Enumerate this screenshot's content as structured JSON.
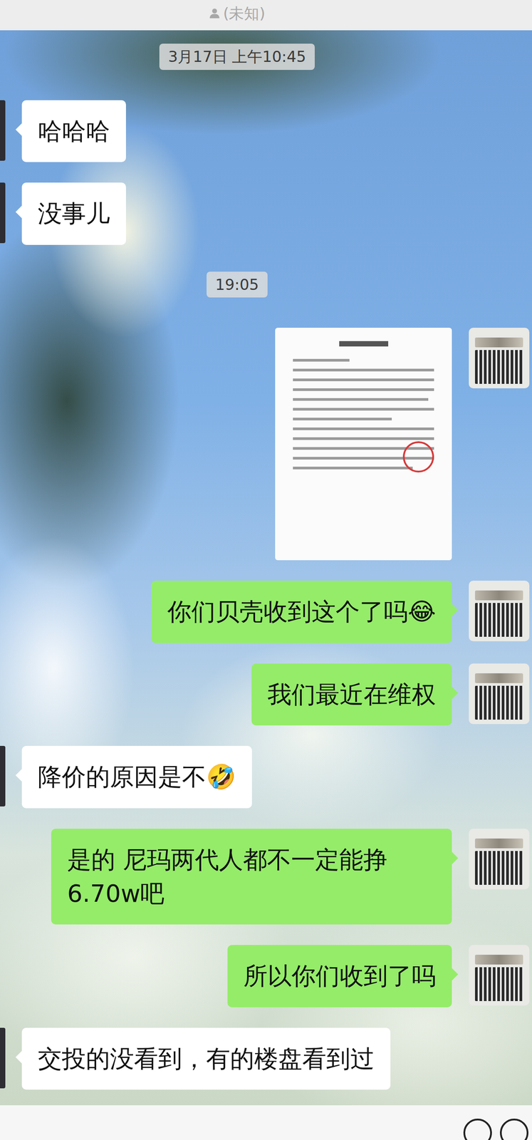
{
  "header": {
    "title": "(未知)"
  },
  "messages": [
    {
      "kind": "time",
      "text": "3月17日 上午10:45"
    },
    {
      "kind": "text",
      "side": "left",
      "text": "哈哈哈"
    },
    {
      "kind": "text",
      "side": "left",
      "text": "没事儿"
    },
    {
      "kind": "time",
      "text": "19:05"
    },
    {
      "kind": "image",
      "side": "right"
    },
    {
      "kind": "text",
      "side": "right",
      "text": "你们贝壳收到这个了吗😂"
    },
    {
      "kind": "text",
      "side": "right",
      "text": "我们最近在维权"
    },
    {
      "kind": "text",
      "side": "left",
      "text": "降价的原因是不🤣"
    },
    {
      "kind": "text",
      "side": "right",
      "text": "是的 尼玛两代人都不一定能挣6.70w吧"
    },
    {
      "kind": "text",
      "side": "right",
      "text": "所以你们收到了吗"
    },
    {
      "kind": "text",
      "side": "left",
      "text": "交投的没看到，有的楼盘看到过"
    }
  ]
}
